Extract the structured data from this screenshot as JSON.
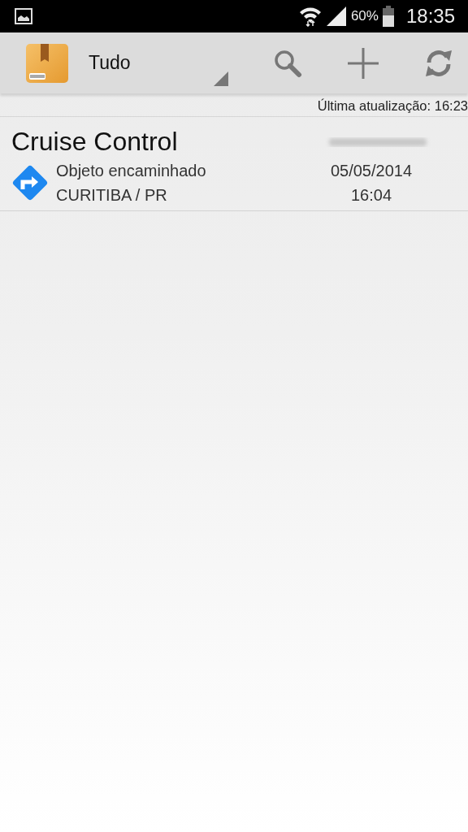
{
  "status_bar": {
    "battery": "60%",
    "time": "18:35"
  },
  "action_bar": {
    "filter": "Tudo"
  },
  "last_update": "Última atualização: 16:23",
  "packages": [
    {
      "name": "Cruise Control",
      "status": "Objeto encaminhado",
      "location": "CURITIBA / PR",
      "date": "05/05/2014",
      "time": "16:04"
    }
  ]
}
